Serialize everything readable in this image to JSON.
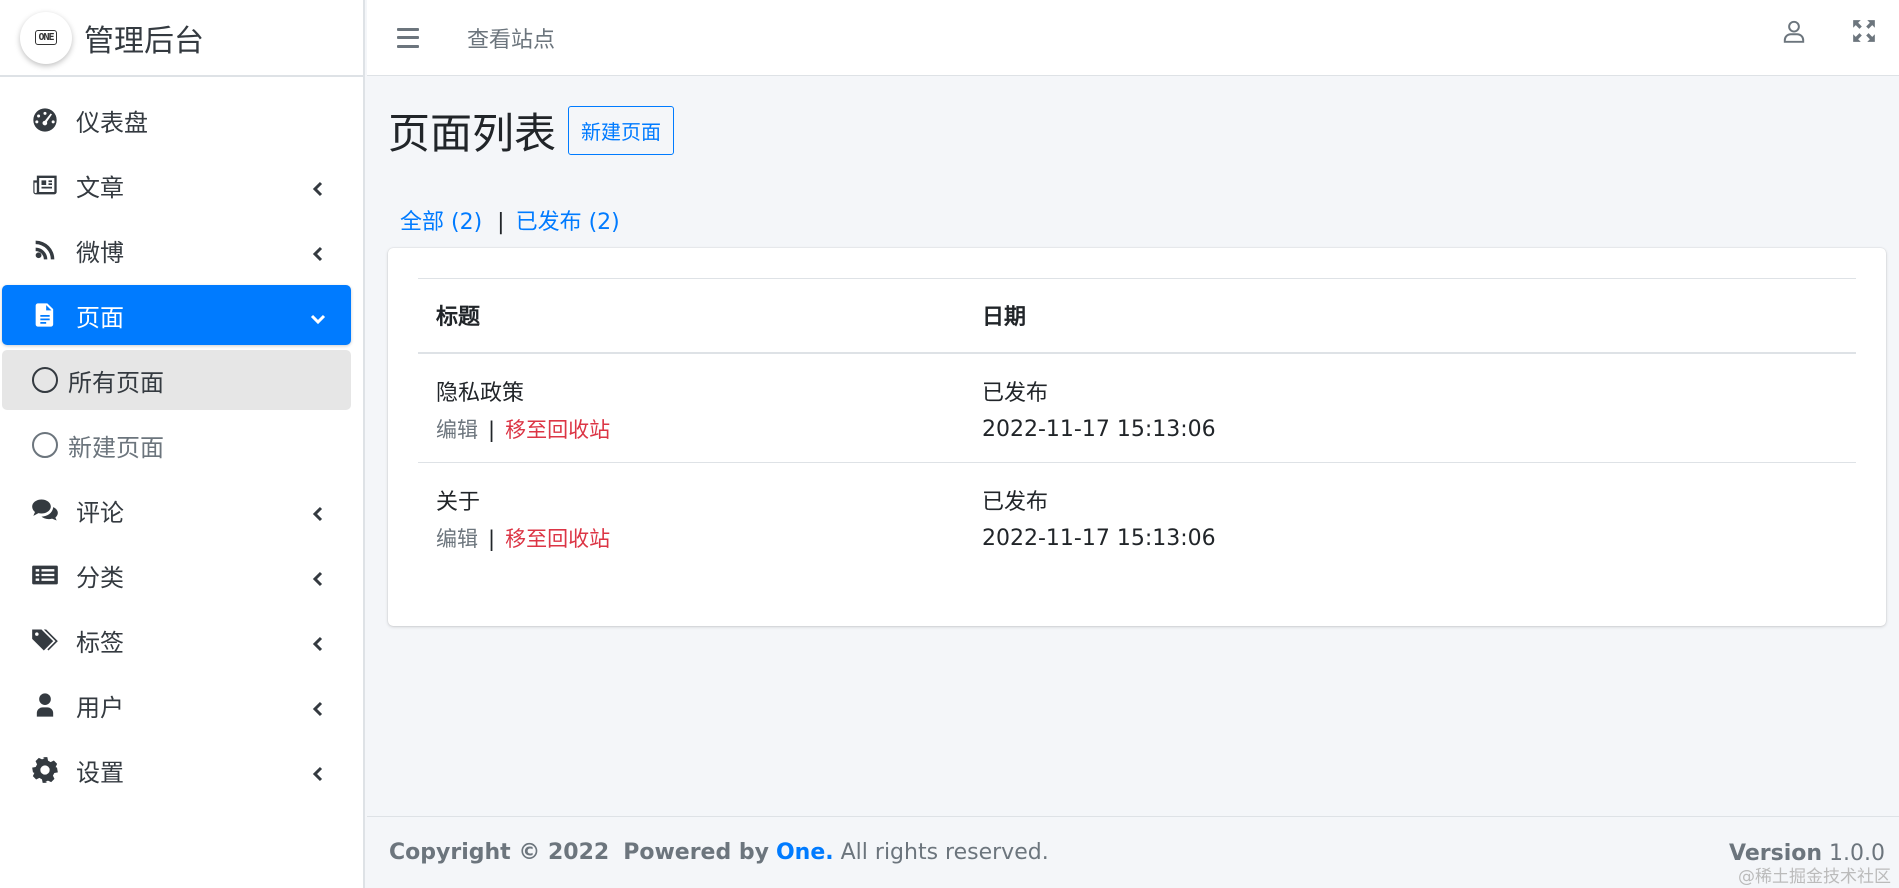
{
  "brand": {
    "logo_text": "ONE",
    "title": "管理后台"
  },
  "sidebar": {
    "items": [
      {
        "label": "仪表盘",
        "icon": "dashboard-icon"
      },
      {
        "label": "文章",
        "icon": "newspaper-icon"
      },
      {
        "label": "微博",
        "icon": "feed-icon"
      },
      {
        "label": "页面",
        "icon": "file-icon",
        "active": true
      },
      {
        "label": "评论",
        "icon": "comments-icon"
      },
      {
        "label": "分类",
        "icon": "list-icon"
      },
      {
        "label": "标签",
        "icon": "tags-icon"
      },
      {
        "label": "用户",
        "icon": "user-icon"
      },
      {
        "label": "设置",
        "icon": "gear-icon"
      }
    ],
    "sub_items": [
      {
        "label": "所有页面",
        "current": true
      },
      {
        "label": "新建页面",
        "current": false
      }
    ]
  },
  "topbar": {
    "view_site": "查看站点"
  },
  "main": {
    "title": "页面列表",
    "new_button": "新建页面",
    "filters": {
      "all": "全部 (2)",
      "separator": "|",
      "published": "已发布 (2)"
    },
    "table": {
      "headers": [
        "标题",
        "日期"
      ],
      "rows": [
        {
          "title": "隐私政策",
          "edit": "编辑",
          "sep": "|",
          "trash": "移至回收站",
          "status": "已发布",
          "date": "2022-11-17 15:13:06"
        },
        {
          "title": "关于",
          "edit": "编辑",
          "sep": "|",
          "trash": "移至回收站",
          "status": "已发布",
          "date": "2022-11-17 15:13:06"
        }
      ]
    }
  },
  "footer": {
    "copyright": "Copyright © 2022",
    "powered_by": "Powered by",
    "brand": "One.",
    "rights": "All rights reserved.",
    "version_label": "Version",
    "version": "1.0.0",
    "watermark": "@稀土掘金技术社区"
  },
  "colors": {
    "accent": "#007bff",
    "danger": "#dc3545",
    "muted": "#6c757d"
  }
}
